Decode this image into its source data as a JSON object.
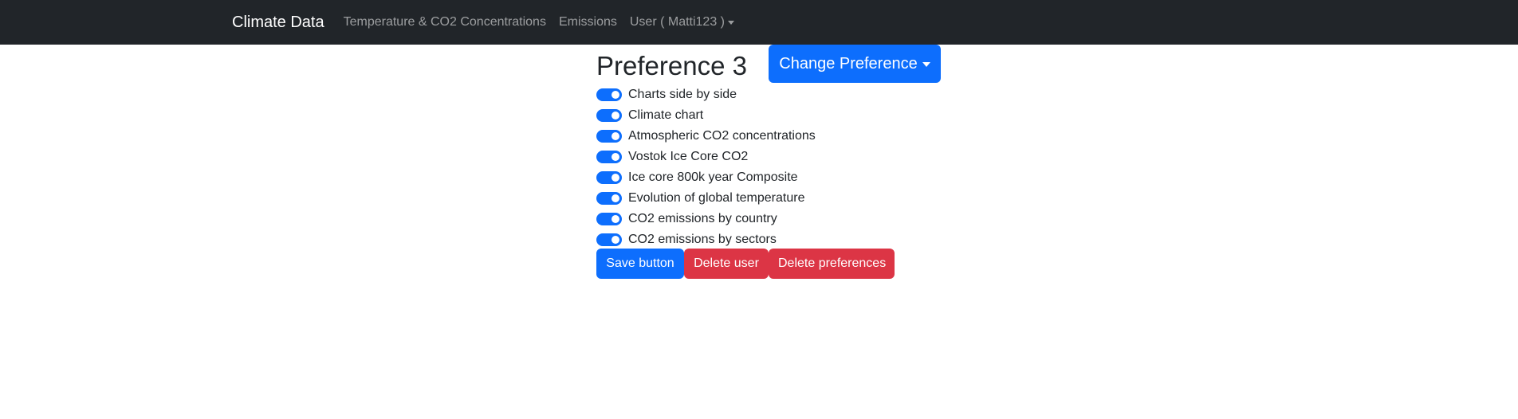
{
  "navbar": {
    "brand": "Climate Data",
    "links": [
      {
        "label": "Temperature & CO2 Concentrations"
      },
      {
        "label": "Emissions"
      },
      {
        "label": "User ( Matti123 )"
      }
    ]
  },
  "main": {
    "title": "Preference 3",
    "change_button": "Change Preference",
    "toggles": [
      {
        "label": "Charts side by side",
        "checked": true
      },
      {
        "label": "Climate chart",
        "checked": true
      },
      {
        "label": "Atmospheric CO2 concentrations",
        "checked": true
      },
      {
        "label": "Vostok Ice Core CO2",
        "checked": true
      },
      {
        "label": "Ice core 800k year Composite",
        "checked": true
      },
      {
        "label": "Evolution of global temperature",
        "checked": true
      },
      {
        "label": "CO2 emissions by country",
        "checked": true
      },
      {
        "label": "CO2 emissions by sectors",
        "checked": true
      }
    ],
    "buttons": {
      "save": "Save button",
      "delete_user": "Delete user",
      "delete_preferences": "Delete preferences"
    }
  },
  "colors": {
    "navbar_bg": "#212529",
    "primary": "#0d6efd",
    "danger": "#dc3545"
  }
}
